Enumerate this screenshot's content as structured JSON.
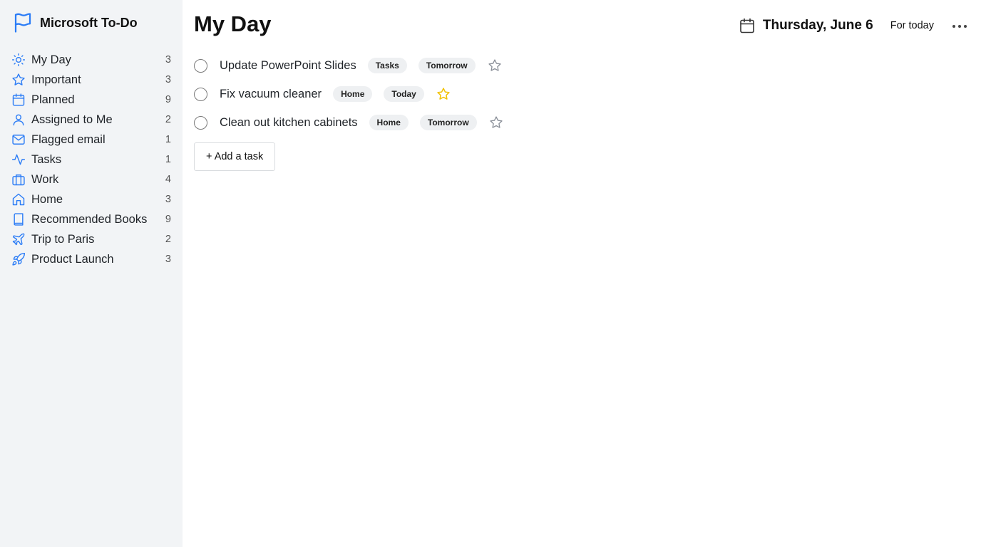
{
  "app": {
    "title": "Microsoft To-Do",
    "accent_color": "#2b7cf6"
  },
  "sidebar": {
    "items": [
      {
        "label": "My Day",
        "count": "3",
        "icon": "sun-icon"
      },
      {
        "label": "Important",
        "count": "3",
        "icon": "star-icon"
      },
      {
        "label": "Planned",
        "count": "9",
        "icon": "calendar-icon"
      },
      {
        "label": "Assigned to Me",
        "count": "2",
        "icon": "person-icon"
      },
      {
        "label": "Flagged email",
        "count": "1",
        "icon": "mail-icon"
      },
      {
        "label": "Tasks",
        "count": "1",
        "icon": "activity-icon"
      },
      {
        "label": "Work",
        "count": "4",
        "icon": "briefcase-icon"
      },
      {
        "label": "Home",
        "count": "3",
        "icon": "home-icon"
      },
      {
        "label": "Recommended Books",
        "count": "9",
        "icon": "book-icon"
      },
      {
        "label": "Trip to Paris",
        "count": "2",
        "icon": "plane-icon"
      },
      {
        "label": "Product Launch",
        "count": "3",
        "icon": "rocket-icon"
      }
    ]
  },
  "header": {
    "title": "My Day",
    "date": "Thursday, June 6",
    "for_today_label": "For today",
    "more_icon": "more-horizontal-icon"
  },
  "tasks": [
    {
      "title": "Update PowerPoint Slides",
      "list": "Tasks",
      "due": "Tomorrow",
      "important": false
    },
    {
      "title": "Fix vacuum cleaner",
      "list": "Home",
      "due": "Today",
      "important": true
    },
    {
      "title": "Clean out kitchen cabinets",
      "list": "Home",
      "due": "Tomorrow",
      "important": false
    }
  ],
  "add_task_label": "+ Add a task",
  "colors": {
    "star_active": "#f2c200",
    "star_inactive": "#8a8f98",
    "sidebar_bg": "#f2f4f6"
  }
}
